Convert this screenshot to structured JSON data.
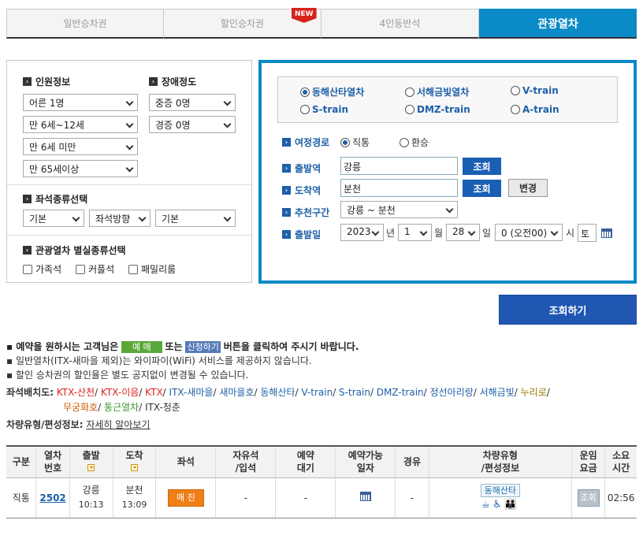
{
  "tabs": [
    {
      "label": "일반승차권"
    },
    {
      "label": "할인승차권",
      "badge": "NEW"
    },
    {
      "label": "4인동반석"
    },
    {
      "label": "관광열차"
    }
  ],
  "left": {
    "passenger_title": "인원정보",
    "disability_title": "장애정도",
    "passengers": [
      "어른 1명",
      "만 6세~12세",
      "만 6세 미만",
      "만 65세이상"
    ],
    "disability": [
      "중증 0명",
      "경증 0명"
    ],
    "seat_title": "좌석종류선택",
    "seat_selects": [
      "기본",
      "좌석방향",
      "기본"
    ],
    "room_title": "관광열차 별실종류선택",
    "room_options": [
      "가족석",
      "커플석",
      "패밀리룸"
    ]
  },
  "trains": [
    {
      "label": "동해산타열차",
      "checked": true
    },
    {
      "label": "서해금빛열차"
    },
    {
      "label": "V-train"
    },
    {
      "label": "S-train"
    },
    {
      "label": "DMZ-train"
    },
    {
      "label": "A-train"
    }
  ],
  "route": {
    "title": "여정경로",
    "direct": "직통",
    "transfer": "환승",
    "dep_label": "출발역",
    "dep_value": "강릉",
    "arr_label": "도착역",
    "arr_value": "분천",
    "lookup": "조회",
    "swap": "변경",
    "rec_label": "추천구간",
    "rec_value": "강릉 ~ 분천",
    "date_label": "출발일",
    "year": "2023",
    "year_unit": "년",
    "month": "1",
    "month_unit": "월",
    "day": "28",
    "day_unit": "일",
    "hour": "0 (오전00)",
    "hour_unit": "시",
    "weekday": "토"
  },
  "search_button": "조회하기",
  "notes": {
    "n1_pre": "예약을 원하시는 고객님은",
    "n1_tag1": "예 매",
    "n1_mid": "또는",
    "n1_tag2": "신청하기",
    "n1_post": "버튼을 클릭하여 주시기 바랍니다.",
    "n2": "일반열차(ITX-새마을 제외)는 와이파이(WiFi) 서비스를 제공하지 않습니다.",
    "n3": "할인 승차권의 할인율은 별도 공지없이 변경될 수 있습니다."
  },
  "seat_layout": {
    "label": "좌석배치도:",
    "line1": [
      {
        "t": "KTX-산천",
        "c": "#d22"
      },
      {
        "t": "KTX-이음",
        "c": "#d22"
      },
      {
        "t": "KTX",
        "c": "#d22"
      },
      {
        "t": "ITX-새마을",
        "c": "#1d5fa8"
      },
      {
        "t": "새마을호",
        "c": "#1d5fa8"
      },
      {
        "t": "동해산타",
        "c": "#1d5fa8"
      },
      {
        "t": "V-train",
        "c": "#1d5fa8"
      },
      {
        "t": "S-train",
        "c": "#1d5fa8"
      },
      {
        "t": "DMZ-train",
        "c": "#1d5fa8"
      },
      {
        "t": "정선아리랑",
        "c": "#1d5fa8"
      },
      {
        "t": "서해금빛",
        "c": "#1d5fa8"
      },
      {
        "t": "누리로",
        "c": "#9a7a00"
      }
    ],
    "line2": [
      {
        "t": "무궁화호",
        "c": "#d25a00"
      },
      {
        "t": "통근열차",
        "c": "#3a9a2a"
      },
      {
        "t": "ITX-청춘",
        "c": "#333"
      }
    ]
  },
  "vehicle": {
    "label": "차량유형/편성정보:",
    "link": "자세히 알아보기"
  },
  "table": {
    "headers": [
      "구분",
      "열차\n번호",
      "출발",
      "도착",
      "좌석",
      "자유석\n/입석",
      "예약\n대기",
      "예약가능\n일자",
      "경유",
      "차량유형\n/편성정보",
      "운임\n요금",
      "소요\n시간"
    ],
    "row": {
      "type": "직통",
      "train_no": "2502",
      "dep_station": "강릉",
      "dep_time": "10:13",
      "arr_station": "분천",
      "arr_time": "13:09",
      "seat": "매 진",
      "free": "-",
      "wait": "-",
      "via": "-",
      "vehicle": "동해산타",
      "fare": "조회",
      "duration": "02:56"
    }
  },
  "colors": {
    "accent": "#0a8bc7",
    "button": "#1f57b3",
    "soldout": "#f07f18"
  }
}
